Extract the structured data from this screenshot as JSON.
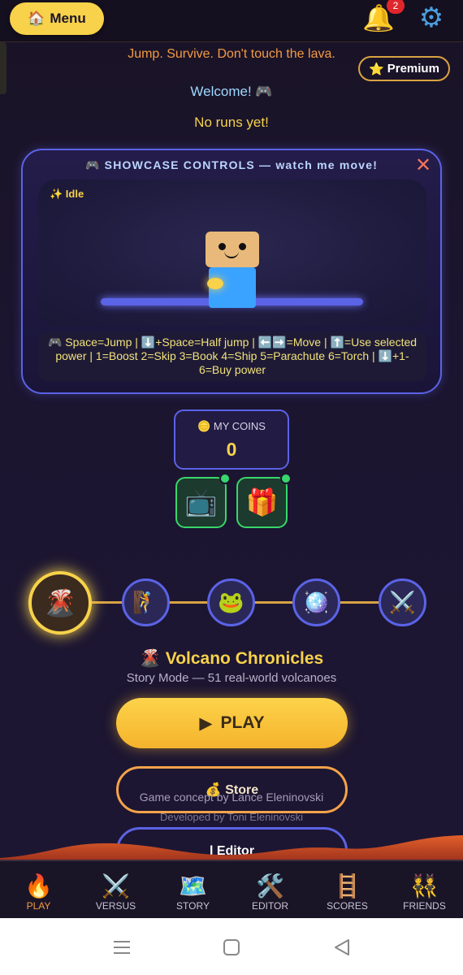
{
  "header": {
    "menu_icon": "🏠",
    "menu_label": "Menu",
    "notification_count": "2",
    "tagline": "Jump. Survive. Don't touch the lava.",
    "premium_label": "Premium",
    "welcome": "Welcome! 🎮",
    "runs_status": "No runs yet!"
  },
  "showcase": {
    "title": "🎮 SHOWCASE CONTROLS — watch me move!",
    "close_label": "✕",
    "state": "✨ Idle",
    "controls": "🎮 Space=Jump | ⬇️+Space=Half jump | ⬅️➡️=Move | ⬆️=Use selected power | 1=Boost 2=Skip 3=Book 4=Ship 5=Parachute 6=Torch | ⬇️+1-6=Buy power"
  },
  "coins": {
    "label": "🪙 MY COINS",
    "value": "0"
  },
  "rewards": [
    {
      "icon": "📺",
      "name": "tv-reward"
    },
    {
      "icon": "🎁",
      "name": "gift-reward"
    }
  ],
  "modes": [
    {
      "icon": "🌋",
      "name": "volcano-mode-icon",
      "active": true
    },
    {
      "icon": "🧗",
      "name": "climber-mode-icon"
    },
    {
      "icon": "🐸",
      "name": "frog-mode-icon"
    },
    {
      "icon": "🪩",
      "name": "disco-mode-icon"
    },
    {
      "icon": "⚔️",
      "name": "swords-mode-icon"
    }
  ],
  "mode_info": {
    "title": "🌋 Volcano Chronicles",
    "subtitle": "Story Mode — 51 real-world volcanoes"
  },
  "buttons": {
    "play_label": "PLAY",
    "store_label": "💰 Store",
    "editor_label": "l Editor"
  },
  "credits": {
    "concept": "Game concept by Lance Eleninovski",
    "developer": "Developed by Toni Eleninovski"
  },
  "nav": [
    {
      "icon": "🔥",
      "label": "PLAY"
    },
    {
      "icon": "⚔️",
      "label": "VERSUS"
    },
    {
      "icon": "🗺️",
      "label": "STORY"
    },
    {
      "icon": "🛠️",
      "label": "EDITOR"
    },
    {
      "icon": "🪜",
      "label": "SCORES"
    },
    {
      "icon": "👯",
      "label": "FRIENDS"
    }
  ],
  "colors": {
    "accent_yellow": "#f7d24a",
    "accent_orange": "#f39a43",
    "accent_blue": "#5b63e6",
    "background": "#1b1530"
  }
}
